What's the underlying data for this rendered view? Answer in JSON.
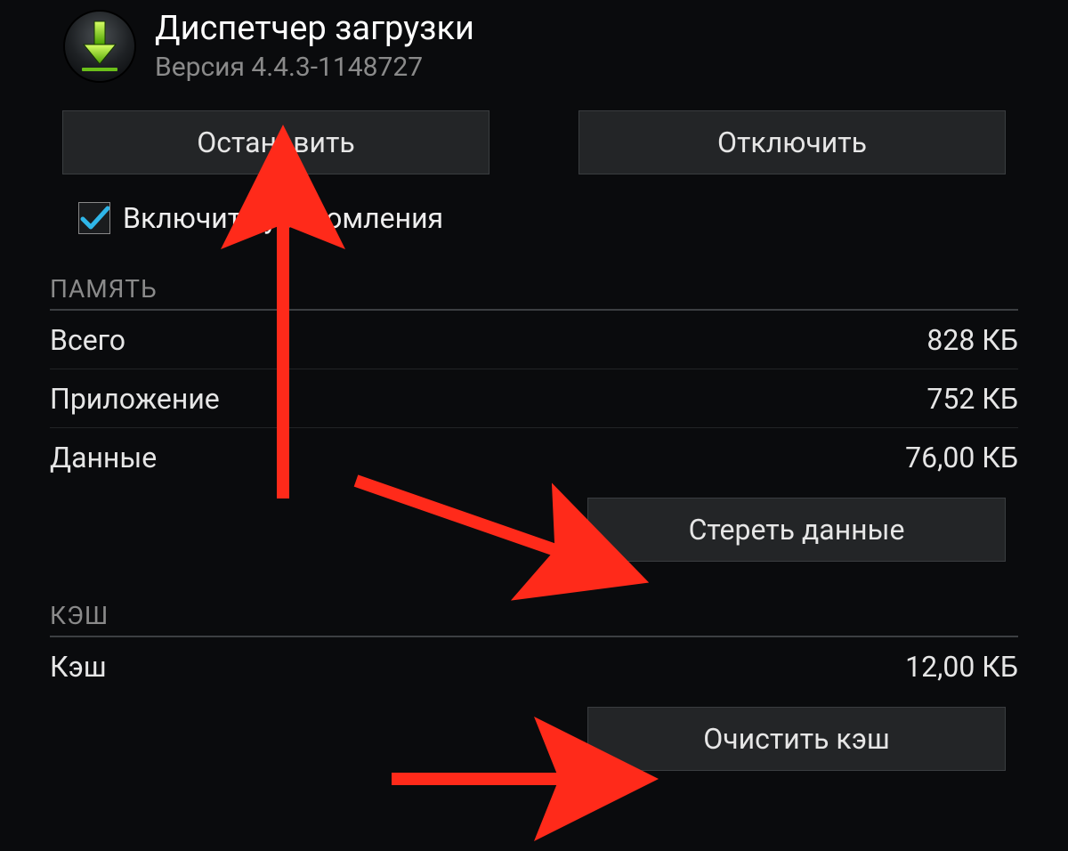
{
  "app": {
    "title": "Диспетчер загрузки",
    "version": "Версия 4.4.3-1148727"
  },
  "buttons": {
    "stop": "Остановить",
    "disable": "Отключить",
    "clear_data": "Стереть данные",
    "clear_cache": "Очистить кэш"
  },
  "checkbox": {
    "notifications_label": "Включить уведомления",
    "checked": true
  },
  "sections": {
    "storage": "ПАМЯТЬ",
    "cache": "КЭШ"
  },
  "storage_rows": {
    "total_label": "Всего",
    "total_value": "828 КБ",
    "app_label": "Приложение",
    "app_value": "752 КБ",
    "data_label": "Данные",
    "data_value": "76,00 КБ"
  },
  "cache_rows": {
    "cache_label": "Кэш",
    "cache_value": "12,00 КБ"
  },
  "icons": {
    "app_icon": "download-icon",
    "checkbox_mark": "checkmark-icon"
  },
  "annotation_color": "#ff2a1a"
}
